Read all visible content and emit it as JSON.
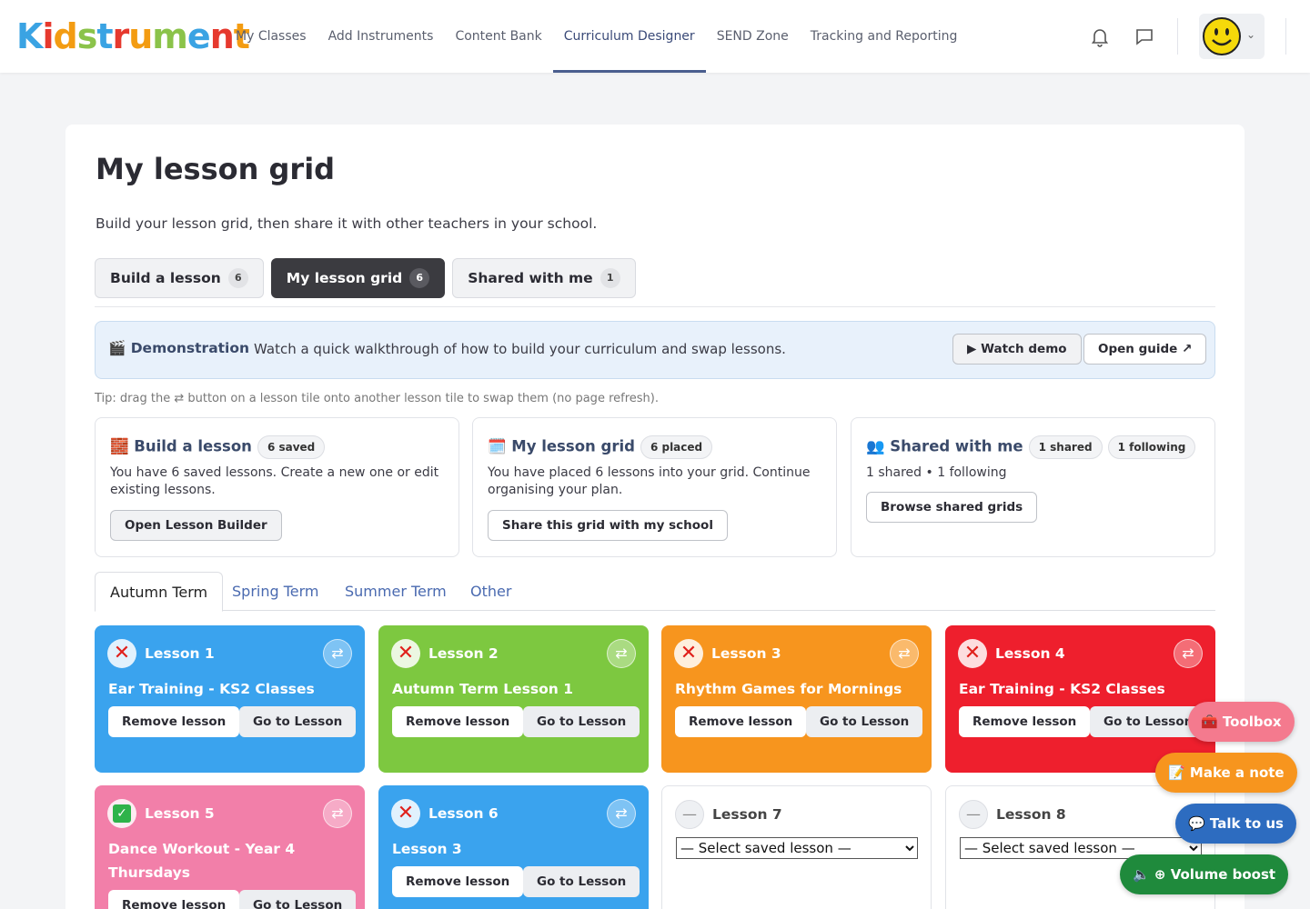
{
  "header": {
    "logo_letters": [
      "K",
      "i",
      "d",
      "s",
      "t",
      "r",
      "u",
      "m",
      "e",
      "n",
      "t"
    ],
    "logo_colors": [
      "#3aa3e3",
      "#e6392e",
      "#f39c12",
      "#8bc34a",
      "#3aa3e3",
      "#e6392e",
      "#f39c12",
      "#8bc34a",
      "#3aa3e3",
      "#e6392e",
      "#f39c12"
    ],
    "nav": [
      "My Classes",
      "Add Instruments",
      "Content Bank",
      "Curriculum Designer",
      "SEND Zone",
      "Tracking and Reporting"
    ],
    "active_nav": "Curriculum Designer"
  },
  "page": {
    "title": "My lesson grid",
    "subtitle": "Build your lesson grid, then share it with other teachers in your school.",
    "tabs": [
      {
        "label": "Build a lesson",
        "count": "6"
      },
      {
        "label": "My lesson grid",
        "count": "6"
      },
      {
        "label": "Shared with me",
        "count": "1"
      }
    ]
  },
  "demo": {
    "label": "🎬 Demonstration",
    "text": "Watch a quick walkthrough of how to build your curriculum and swap lessons.",
    "watch": "▶ Watch demo",
    "guide": "Open guide ↗"
  },
  "tip": "Tip: drag the ⇄ button on a lesson tile onto another lesson tile to swap them (no page refresh).",
  "info_cards": [
    {
      "title": "🧱 Build a lesson",
      "chips": [
        "6 saved"
      ],
      "text": "You have 6 saved lessons. Create a new one or edit existing lessons.",
      "button": "Open Lesson Builder"
    },
    {
      "title": "🗓️ My lesson grid",
      "chips": [
        "6 placed"
      ],
      "text": "You have placed 6 lessons into your grid. Continue organising your plan.",
      "button": "Share this grid with my school"
    },
    {
      "title": "👥 Shared with me",
      "chips": [
        "1 shared",
        "1 following"
      ],
      "text": "1 shared • 1 following",
      "button": "Browse shared grids"
    }
  ],
  "terms": [
    "Autumn Term",
    "Spring Term",
    "Summer Term",
    "Other"
  ],
  "tiles": [
    {
      "name": "Lesson 1",
      "title": "Ear Training - KS2 Classes",
      "color": "#3aa3ee",
      "status": "x"
    },
    {
      "name": "Lesson 2",
      "title": "Autumn Term Lesson 1",
      "color": "#7dc840",
      "status": "x"
    },
    {
      "name": "Lesson 3",
      "title": "Rhythm Games for Mornings",
      "color": "#f7951e",
      "status": "x"
    },
    {
      "name": "Lesson 4",
      "title": "Ear Training - KS2 Classes",
      "color": "#ee1f2d",
      "status": "x"
    },
    {
      "name": "Lesson 5",
      "title": "Dance Workout - Year 4 Thursdays",
      "color": "#f27fa9",
      "status": "check"
    },
    {
      "name": "Lesson 6",
      "title": "Lesson 3",
      "color": "#3aa3ee",
      "status": "x"
    },
    {
      "name": "Lesson 7",
      "select": "— Select saved lesson —"
    },
    {
      "name": "Lesson 8",
      "select": "— Select saved lesson —"
    }
  ],
  "tile_buttons": {
    "remove": "Remove lesson",
    "go": "Go to Lesson"
  },
  "fabs": [
    {
      "label": "🧰 Toolbox",
      "color": "#f47a8e"
    },
    {
      "label": "📝 Make a note",
      "color": "#f7951e"
    },
    {
      "label": "💬 Talk to us",
      "color": "#2d6cc0"
    },
    {
      "label": "🔈 ⊕ Volume boost",
      "color": "#1f8a3c"
    }
  ]
}
